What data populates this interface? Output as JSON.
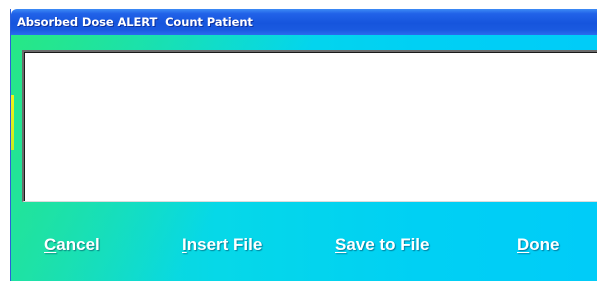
{
  "window": {
    "title": "Absorbed Dose ALERT  Count Patient"
  },
  "message_box": {
    "value": ""
  },
  "buttons": {
    "cancel": {
      "mnemonic": "C",
      "rest": "ancel"
    },
    "insert": {
      "mnemonic": "I",
      "rest": "nsert File"
    },
    "save": {
      "mnemonic": "S",
      "rest": "ave to File"
    },
    "done": {
      "mnemonic": "D",
      "rest": "one"
    }
  },
  "colors": {
    "titlebar": "#1655dd",
    "client_left": "#28e882",
    "client_right": "#00ccf8",
    "button_text": "#ffffff"
  }
}
